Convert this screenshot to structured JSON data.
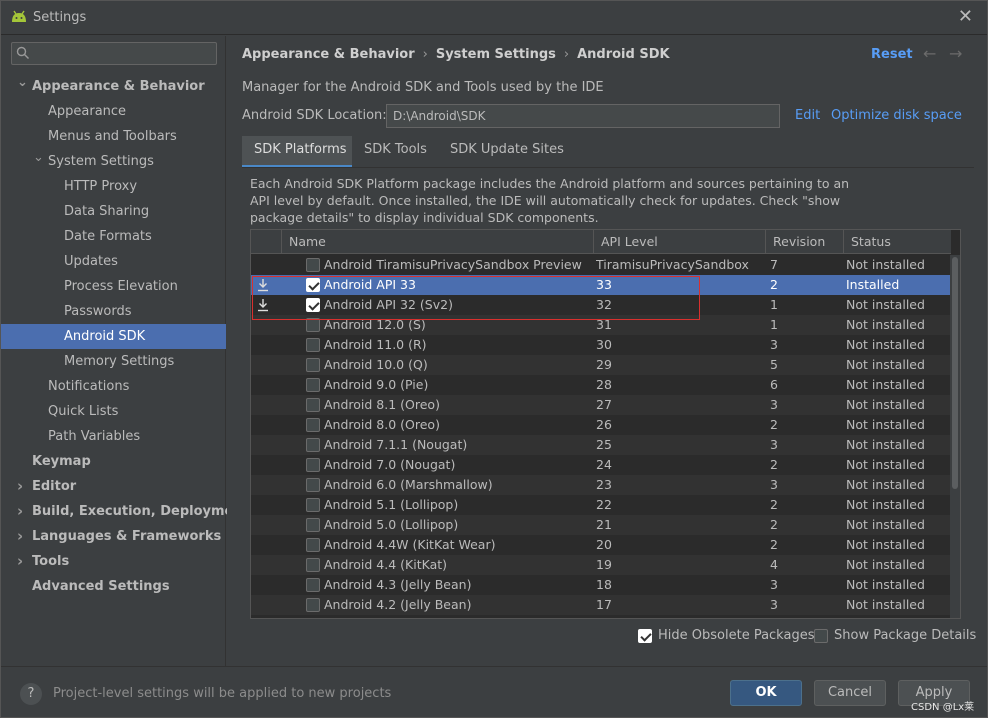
{
  "window": {
    "title": "Settings"
  },
  "sidebar": {
    "search_placeholder": "",
    "items": [
      {
        "label": "Appearance & Behavior",
        "level": 0,
        "bold": true,
        "arrow": "expanded"
      },
      {
        "label": "Appearance",
        "level": 1
      },
      {
        "label": "Menus and Toolbars",
        "level": 1
      },
      {
        "label": "System Settings",
        "level": 1,
        "arrow": "expanded"
      },
      {
        "label": "HTTP Proxy",
        "level": 2
      },
      {
        "label": "Data Sharing",
        "level": 2
      },
      {
        "label": "Date Formats",
        "level": 2
      },
      {
        "label": "Updates",
        "level": 2
      },
      {
        "label": "Process Elevation",
        "level": 2
      },
      {
        "label": "Passwords",
        "level": 2
      },
      {
        "label": "Android SDK",
        "level": 2,
        "selected": true
      },
      {
        "label": "Memory Settings",
        "level": 2
      },
      {
        "label": "Notifications",
        "level": 1
      },
      {
        "label": "Quick Lists",
        "level": 1
      },
      {
        "label": "Path Variables",
        "level": 1
      },
      {
        "label": "Keymap",
        "level": 0,
        "bold": true
      },
      {
        "label": "Editor",
        "level": 0,
        "bold": true,
        "arrow": "collapsed"
      },
      {
        "label": "Build, Execution, Deployment",
        "level": 0,
        "bold": true,
        "arrow": "collapsed"
      },
      {
        "label": "Languages & Frameworks",
        "level": 0,
        "bold": true,
        "arrow": "collapsed"
      },
      {
        "label": "Tools",
        "level": 0,
        "bold": true,
        "arrow": "collapsed"
      },
      {
        "label": "Advanced Settings",
        "level": 0,
        "bold": true
      }
    ]
  },
  "main": {
    "breadcrumb": [
      "Appearance & Behavior",
      "System Settings",
      "Android SDK"
    ],
    "reset_label": "Reset",
    "description": "Manager for the Android SDK and Tools used by the IDE",
    "sdk_location_label": "Android SDK Location:",
    "sdk_location_value": "D:\\Android\\SDK",
    "edit_label": "Edit",
    "optimize_label": "Optimize disk space",
    "tabs": [
      "SDK Platforms",
      "SDK Tools",
      "SDK Update Sites"
    ],
    "panel_text": "Each Android SDK Platform package includes the Android platform and sources pertaining to an API level by default. Once installed, the IDE will automatically check for updates. Check \"show package details\" to display individual SDK components.",
    "table": {
      "columns": [
        "Name",
        "API Level",
        "Revision",
        "Status"
      ],
      "rows": [
        {
          "checked": false,
          "name": "Android TiramisuPrivacySandbox Preview",
          "api": "TiramisuPrivacySandbox",
          "revision": "7",
          "status": "Not installed"
        },
        {
          "checked": true,
          "download": true,
          "selected": true,
          "name": "Android API 33",
          "api": "33",
          "revision": "2",
          "status": "Installed"
        },
        {
          "checked": true,
          "download": true,
          "name": "Android API 32 (Sv2)",
          "api": "32",
          "revision": "1",
          "status": "Not installed"
        },
        {
          "checked": false,
          "name": "Android 12.0 (S)",
          "api": "31",
          "revision": "1",
          "status": "Not installed"
        },
        {
          "checked": false,
          "name": "Android 11.0 (R)",
          "api": "30",
          "revision": "3",
          "status": "Not installed"
        },
        {
          "checked": false,
          "name": "Android 10.0 (Q)",
          "api": "29",
          "revision": "5",
          "status": "Not installed"
        },
        {
          "checked": false,
          "name": "Android 9.0 (Pie)",
          "api": "28",
          "revision": "6",
          "status": "Not installed"
        },
        {
          "checked": false,
          "name": "Android 8.1 (Oreo)",
          "api": "27",
          "revision": "3",
          "status": "Not installed"
        },
        {
          "checked": false,
          "name": "Android 8.0 (Oreo)",
          "api": "26",
          "revision": "2",
          "status": "Not installed"
        },
        {
          "checked": false,
          "name": "Android 7.1.1 (Nougat)",
          "api": "25",
          "revision": "3",
          "status": "Not installed"
        },
        {
          "checked": false,
          "name": "Android 7.0 (Nougat)",
          "api": "24",
          "revision": "2",
          "status": "Not installed"
        },
        {
          "checked": false,
          "name": "Android 6.0 (Marshmallow)",
          "api": "23",
          "revision": "3",
          "status": "Not installed"
        },
        {
          "checked": false,
          "name": "Android 5.1 (Lollipop)",
          "api": "22",
          "revision": "2",
          "status": "Not installed"
        },
        {
          "checked": false,
          "name": "Android 5.0 (Lollipop)",
          "api": "21",
          "revision": "2",
          "status": "Not installed"
        },
        {
          "checked": false,
          "name": "Android 4.4W (KitKat Wear)",
          "api": "20",
          "revision": "2",
          "status": "Not installed"
        },
        {
          "checked": false,
          "name": "Android 4.4 (KitKat)",
          "api": "19",
          "revision": "4",
          "status": "Not installed"
        },
        {
          "checked": false,
          "name": "Android 4.3 (Jelly Bean)",
          "api": "18",
          "revision": "3",
          "status": "Not installed"
        },
        {
          "checked": false,
          "name": "Android 4.2 (Jelly Bean)",
          "api": "17",
          "revision": "3",
          "status": "Not installed"
        }
      ]
    },
    "hide_obsolete_label": "Hide Obsolete Packages",
    "hide_obsolete_checked": true,
    "show_details_label": "Show Package Details",
    "show_details_checked": false
  },
  "footer": {
    "help_label": "?",
    "note": "Project-level settings will be applied to new projects",
    "ok_label": "OK",
    "cancel_label": "Cancel",
    "apply_label": "Apply"
  },
  "watermark": "CSDN @Lx莱",
  "colors": {
    "accent": "#4b6eaf",
    "link": "#589df6",
    "highlight_box": "#d9302e",
    "android_green": "#a4c639"
  }
}
